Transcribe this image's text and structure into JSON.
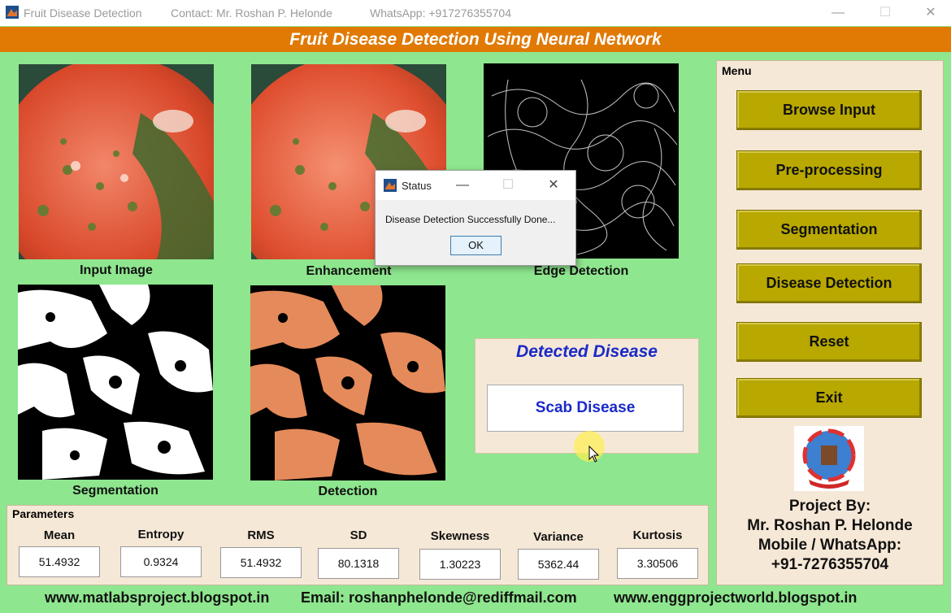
{
  "titlebar": {
    "app_title": "Fruit Disease Detection",
    "contact": "Contact: Mr. Roshan P. Helonde",
    "whatsapp": "WhatsApp: +917276355704",
    "minimize": "—",
    "maximize": "☐",
    "close": "✕"
  },
  "banner": {
    "title": "Fruit Disease Detection Using Neural Network"
  },
  "images": {
    "input_label": "Input Image",
    "enhancement_label": "Enhancement",
    "edge_label": "Edge Detection",
    "segmentation_label": "Segmentation",
    "detection_label": "Detection"
  },
  "detected": {
    "title": "Detected Disease",
    "value": "Scab Disease"
  },
  "menu": {
    "title": "Menu",
    "buttons": [
      "Browse Input",
      "Pre-processing",
      "Segmentation",
      "Disease Detection",
      "Reset",
      "Exit"
    ]
  },
  "project": {
    "line1": "Project By:",
    "line2": "Mr. Roshan P. Helonde",
    "line3": "Mobile / WhatsApp:",
    "line4": "+91-7276355704"
  },
  "parameters": {
    "title": "Parameters",
    "items": [
      {
        "label": "Mean",
        "value": "51.4932"
      },
      {
        "label": "Entropy",
        "value": "0.9324"
      },
      {
        "label": "RMS",
        "value": "51.4932"
      },
      {
        "label": "SD",
        "value": "80.1318"
      },
      {
        "label": "Skewness",
        "value": "1.30223"
      },
      {
        "label": "Variance",
        "value": "5362.44"
      },
      {
        "label": "Kurtosis",
        "value": "3.30506"
      }
    ]
  },
  "footer": {
    "site1": "www.matlabsproject.blogspot.in",
    "email": "Email: roshanphelonde@rediffmail.com",
    "site2": "www.enggprojectworld.blogspot.in"
  },
  "dialog": {
    "title": "Status",
    "message": "Disease Detection Successfully Done...",
    "ok_label": "OK",
    "minimize": "—",
    "maximize": "☐",
    "close": "✕"
  },
  "colors": {
    "background": "#8ee68e",
    "banner": "#e07a05",
    "menu_button": "#b8a800",
    "detected_text": "#1a2ac8"
  }
}
